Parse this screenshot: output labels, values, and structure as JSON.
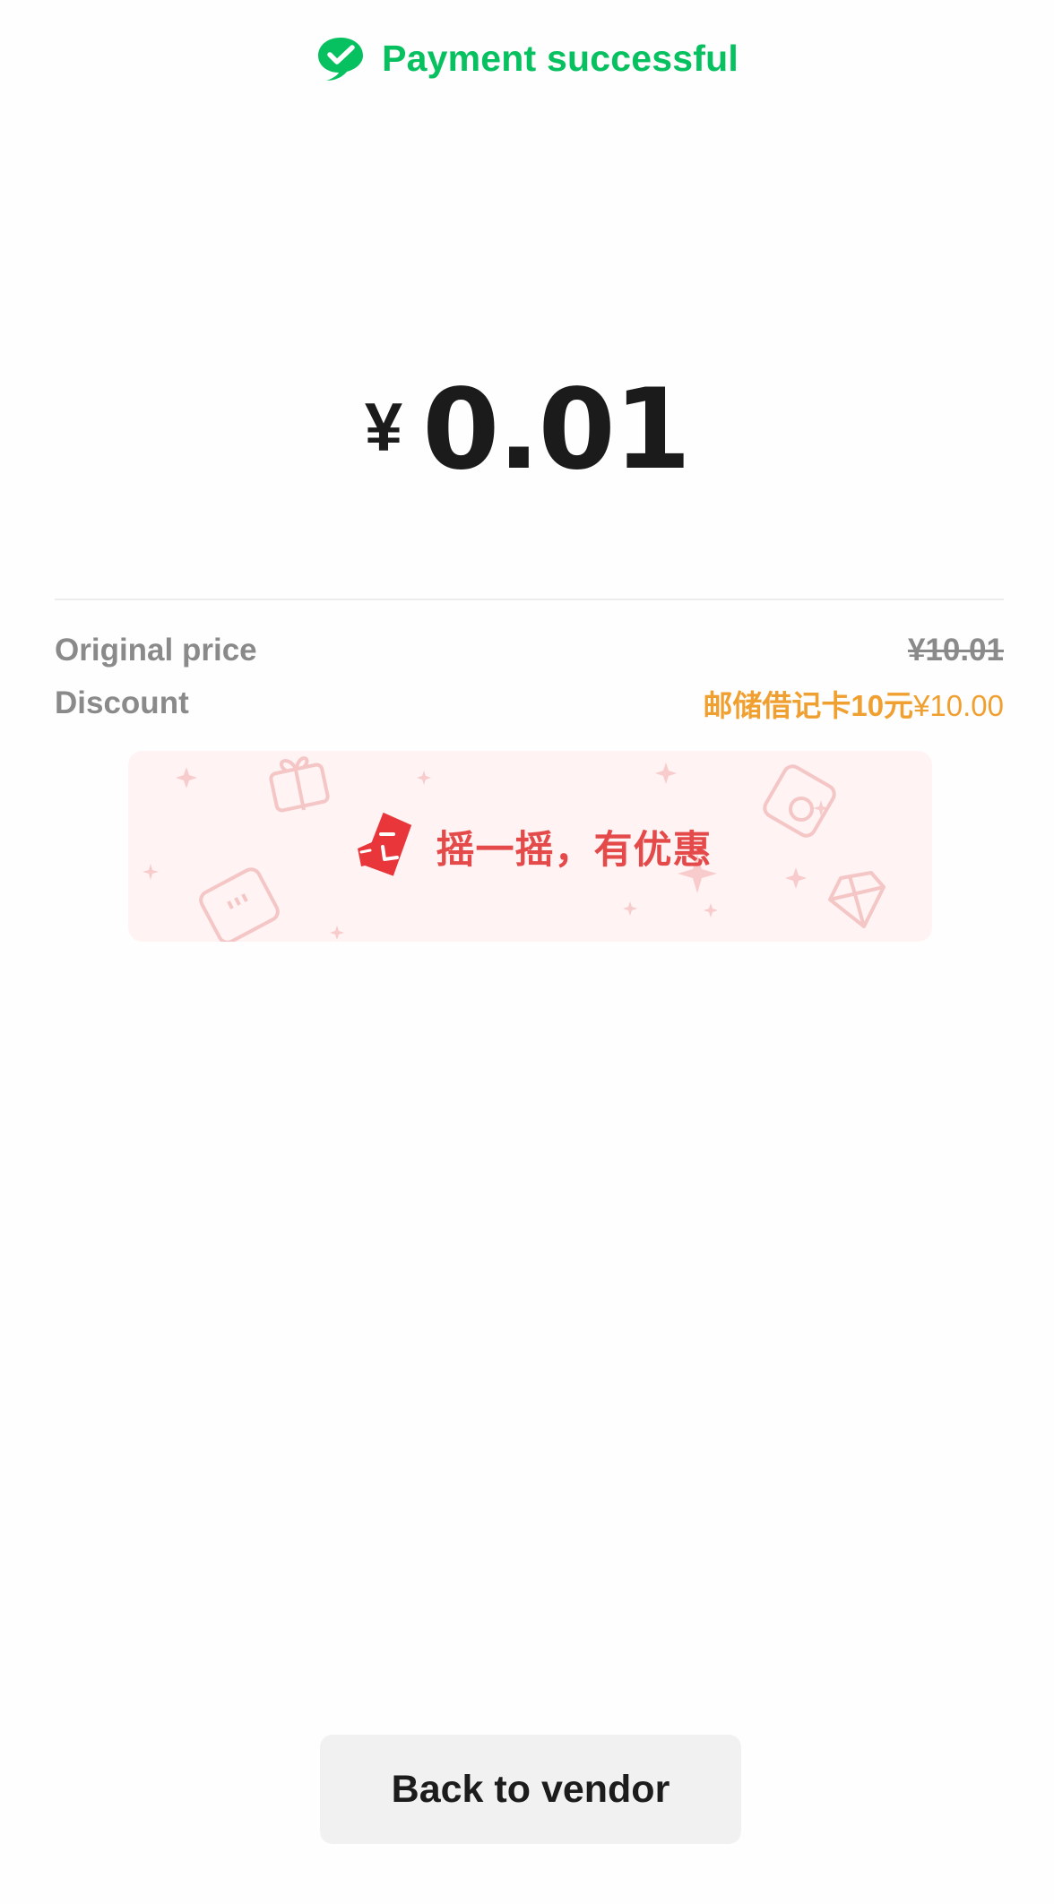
{
  "header": {
    "title": "Payment successful",
    "icon": "wechat-pay-check-icon",
    "color": "#07c160"
  },
  "amount": {
    "currency": "¥",
    "value": "0.01"
  },
  "details": {
    "original_label": "Original price",
    "original_value": "¥10.01",
    "discount_label": "Discount",
    "discount_card": "邮储借记卡10元",
    "discount_amount": "¥10.00",
    "discount_color": "#f0a030"
  },
  "banner": {
    "text": "摇一摇，有优惠",
    "icon": "shake-phone-icon"
  },
  "footer": {
    "back_label": "Back to vendor"
  }
}
